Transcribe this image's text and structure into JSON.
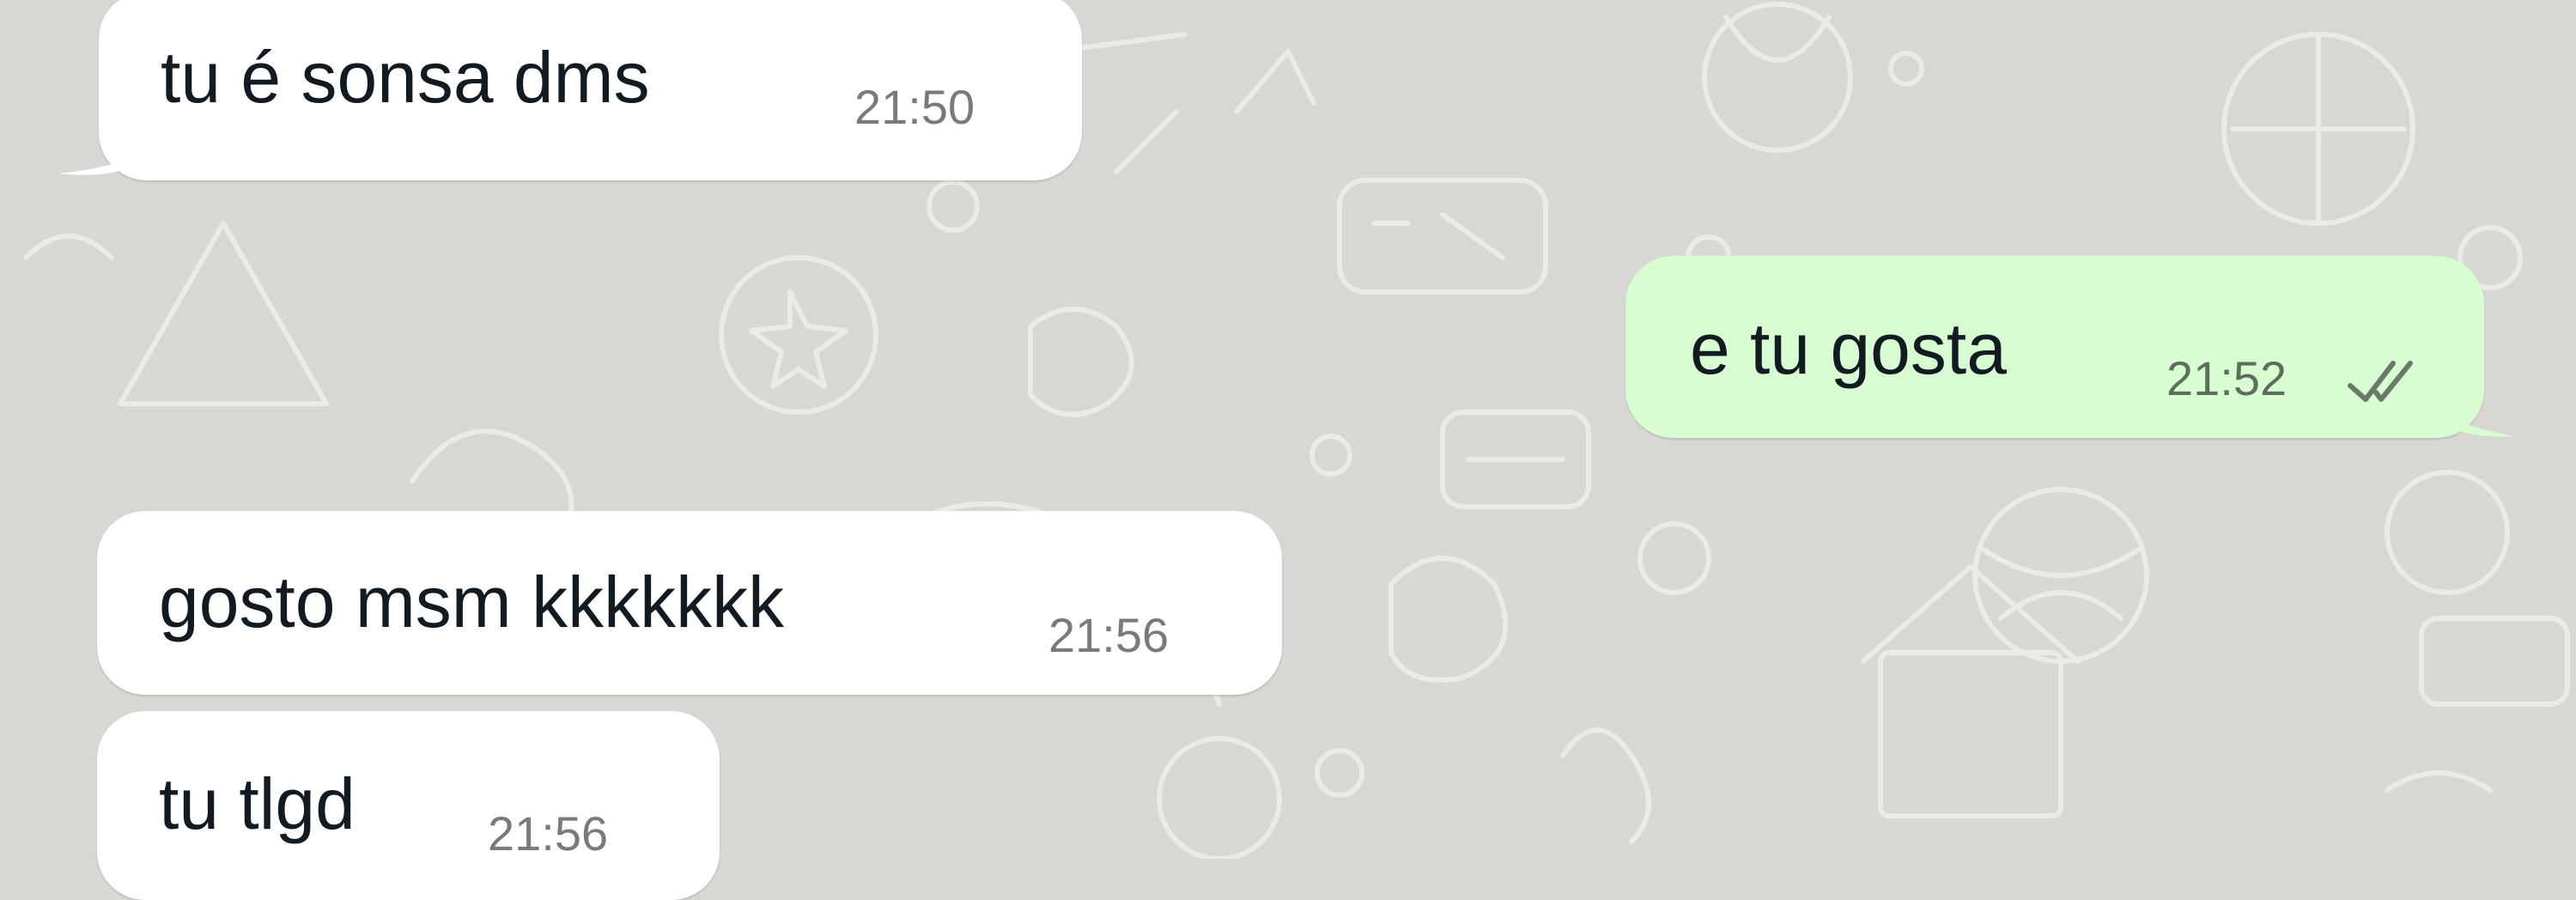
{
  "chat": {
    "messages": [
      {
        "direction": "incoming",
        "text": "tu é sonsa dms",
        "time": "21:50"
      },
      {
        "direction": "outgoing",
        "text": "e tu gosta",
        "time": "21:52",
        "status_icon": "double-check-icon"
      },
      {
        "direction": "incoming",
        "text": "gosto msm kkkkkkk",
        "time": "21:56"
      },
      {
        "direction": "incoming",
        "text": "tu tlgd",
        "time": "21:56"
      }
    ]
  },
  "colors": {
    "background": "#d9d7d3",
    "incoming_bubble": "#ffffff",
    "outgoing_bubble": "#d9fdd3",
    "text": "#111b21",
    "timestamp": "#7a7a7a",
    "doodle_pattern": "#e9e7e3"
  },
  "background": {
    "pattern_icon": "doodle-pattern"
  }
}
